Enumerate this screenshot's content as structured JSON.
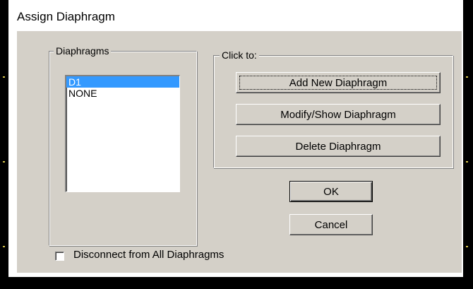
{
  "dialog": {
    "title": "Assign Diaphragm"
  },
  "diaphragms": {
    "legend": "Diaphragms",
    "items": [
      {
        "label": "D1",
        "selected": true
      },
      {
        "label": "NONE",
        "selected": false
      }
    ]
  },
  "click_to": {
    "legend": "Click to:",
    "add_label": "Add New Diaphragm",
    "modify_label": "Modify/Show Diaphragm",
    "delete_label": "Delete Diaphragm"
  },
  "buttons": {
    "ok_label": "OK",
    "cancel_label": "Cancel"
  },
  "options": {
    "disconnect_label": "Disconnect from All Diaphragms",
    "disconnect_checked": false
  },
  "colors": {
    "selection": "#3399ff",
    "face": "#d4d0c8"
  }
}
